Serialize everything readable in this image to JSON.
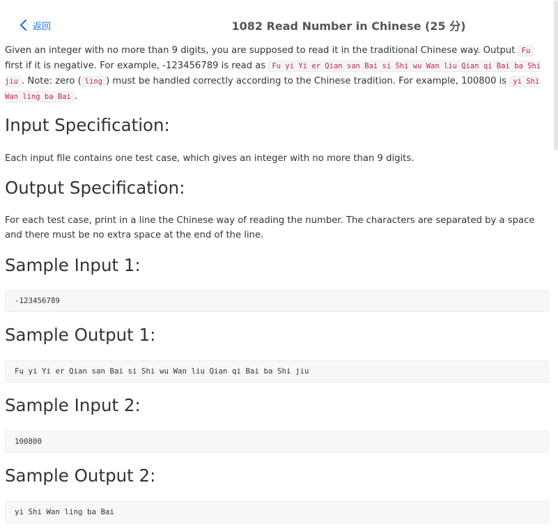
{
  "header": {
    "back_label": "返回",
    "title": "1082 Read Number in Chinese (25 分)"
  },
  "description": {
    "p1": "Given an integer with no more than 9 digits, you are supposed to read it in the traditional Chinese way. Output ",
    "code_fu": "Fu",
    "p2": " first if it is negative. For example, -123456789 is read as ",
    "code_example": "Fu yi Yi er Qian san Bai si Shi wu Wan liu Qian qi Bai ba Shi jiu",
    "p3": ". Note: zero (",
    "code_ling": "ling",
    "p4": ") must be handled correctly according to the Chinese tradition. For example, 100800 is ",
    "code_example2": "yi Shi Wan ling ba Bai",
    "p5": "."
  },
  "sections": {
    "input_spec_title": "Input Specification:",
    "input_spec_text": "Each input file contains one test case, which gives an integer with no more than 9 digits.",
    "output_spec_title": "Output Specification:",
    "output_spec_text": "For each test case, print in a line the Chinese way of reading the number. The characters are separated by a space and there must be no extra space at the end of the line.",
    "sample_input_1_title": "Sample Input 1:",
    "sample_input_1": "-123456789",
    "sample_output_1_title": "Sample Output 1:",
    "sample_output_1": "Fu yi Yi er Qian san Bai si Shi wu Wan liu Qian qi Bai ba Shi jiu",
    "sample_input_2_title": "Sample Input 2:",
    "sample_input_2": "100800",
    "sample_output_2_title": "Sample Output 2:",
    "sample_output_2": "yi Shi Wan ling ba Bai"
  },
  "icons": {
    "back": "chevron-left-icon"
  },
  "colors": {
    "link": "#1a73e8",
    "inline_code": "#c7254e",
    "code_bg": "#f7f7f7"
  }
}
